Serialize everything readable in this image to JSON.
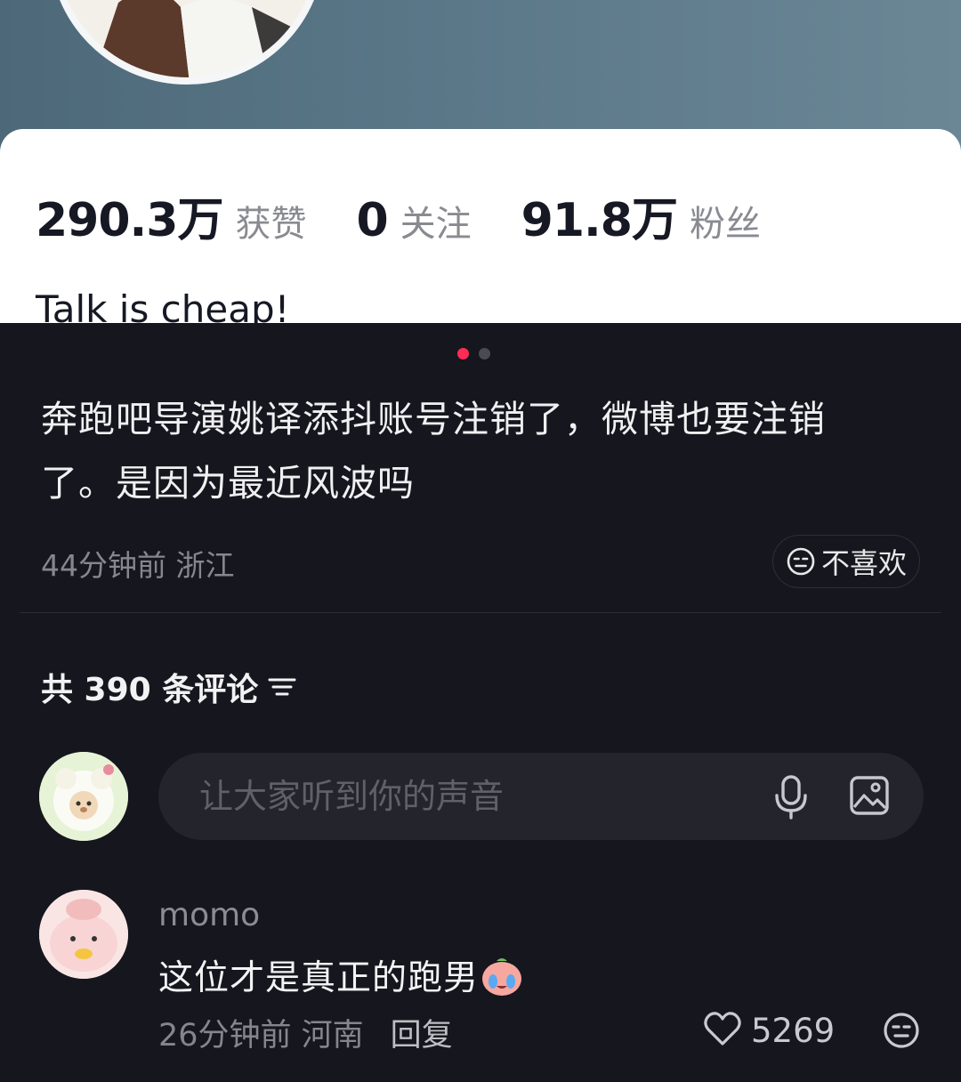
{
  "profile": {
    "stats": [
      {
        "value": "290.3万",
        "label": "获赞"
      },
      {
        "value": "0",
        "label": "关注"
      },
      {
        "value": "91.8万",
        "label": "粉丝"
      }
    ],
    "bio": "Talk is cheap!"
  },
  "post": {
    "carousel": {
      "total": 2,
      "active": 1,
      "active_color": "#fe2c55",
      "inactive_color": "#4a4b52"
    },
    "text": "奔跑吧导演姚译添抖账号注销了，微博也要注销了。是因为最近风波吗",
    "meta": "44分钟前 浙江",
    "dislike_label": "不喜欢"
  },
  "comments": {
    "count_label": "共 390 条评论",
    "input_placeholder": "让大家听到你的声音",
    "items": [
      {
        "user": "momo",
        "text": "这位才是真正的跑男",
        "emoji": "crying-emoji",
        "meta": "26分钟前 河南",
        "reply_label": "回复",
        "likes": "5269"
      }
    ]
  },
  "icons": {
    "filter": "sort-filter-icon",
    "mic": "microphone-icon",
    "image": "image-icon",
    "like": "heart-icon",
    "dislike": "dislike-face-icon"
  }
}
